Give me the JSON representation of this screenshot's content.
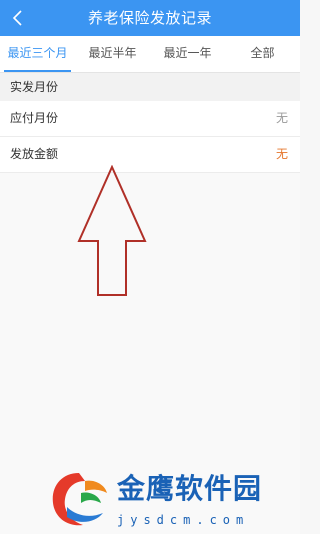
{
  "header": {
    "title": "养老保险发放记录"
  },
  "tabs": [
    {
      "label": "最近三个月",
      "active": true
    },
    {
      "label": "最近半年",
      "active": false
    },
    {
      "label": "最近一年",
      "active": false
    },
    {
      "label": "全部",
      "active": false
    }
  ],
  "section": {
    "title": "实发月份"
  },
  "rows": [
    {
      "label": "应付月份",
      "value": "无"
    },
    {
      "label": "发放金额",
      "value": "无"
    }
  ],
  "watermark": {
    "brand": "金鹰软件园",
    "url": "jysdcm.com"
  },
  "colors": {
    "accent": "#3b95f2",
    "amount_value": "#e5752b",
    "arrow": "#b03028"
  }
}
